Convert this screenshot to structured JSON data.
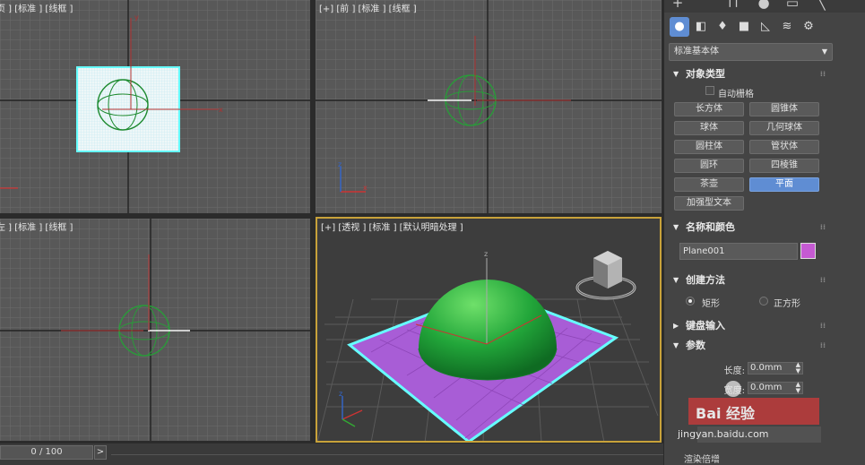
{
  "viewports": {
    "top": {
      "label": "页 ] [标准 ] [线框 ]"
    },
    "front": {
      "label": "[+] [前 ] [标准 ] [线框 ]"
    },
    "left": {
      "label": "左 ] [标准 ] [线框 ]"
    },
    "perspective": {
      "label": "[+] [透视 ] [标准 ] [默认明暗处理 ]"
    }
  },
  "timebar": {
    "frame": "0 / 100",
    "next": ">"
  },
  "panel": {
    "dropdown": "标准基本体",
    "object_type": {
      "title": "对象类型",
      "autogrid": "自动栅格",
      "buttons": [
        "长方体",
        "圆锥体",
        "球体",
        "几何球体",
        "圆柱体",
        "管状体",
        "圆环",
        "四棱锥",
        "茶壶",
        "平面",
        "加强型文本"
      ],
      "active": "平面"
    },
    "name_color": {
      "title": "名称和颜色",
      "name": "Plane001",
      "color": "#c55ad2"
    },
    "creation_method": {
      "title": "创建方法",
      "options": [
        "矩形",
        "正方形"
      ],
      "selected": "矩形"
    },
    "keyboard_entry": {
      "title": "键盘输入"
    },
    "parameters": {
      "title": "参数",
      "length_label": "长度:",
      "length_value": "0.0mm",
      "width_label": "宽度:",
      "width_value": "0.0mm",
      "render_label": "渲染倍增"
    }
  },
  "watermark": {
    "brand": "Bai 经验",
    "url": "jingyan.baidu.com"
  },
  "colors": {
    "accent": "#5f8dd3",
    "selection": "#7fffff",
    "sphere": "#2db34a",
    "plane": "#a85dd6"
  }
}
